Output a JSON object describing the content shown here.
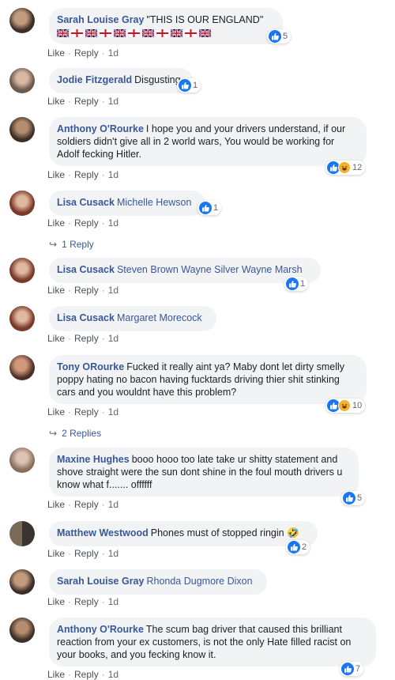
{
  "actions": {
    "like": "Like",
    "reply": "Reply",
    "sep": "·"
  },
  "colors": {
    "link": "#385898",
    "bubble": "#f2f3f5",
    "like_blue": "#1877f2",
    "haha_yellow": "#f7b125"
  },
  "flags_icons": [
    "uk-flag-icon",
    "england-flag-icon",
    "uk-flag-icon",
    "england-flag-icon",
    "uk-flag-icon",
    "england-flag-icon",
    "uk-flag-icon",
    "england-flag-icon",
    "uk-flag-icon",
    "england-flag-icon",
    "uk-flag-icon"
  ],
  "comments": [
    {
      "author": "Sarah Louise Gray",
      "text": "\"THIS IS OUR ENGLAND\"",
      "time": "1d",
      "reactions": "5",
      "reaction_icons": [
        "like-icon"
      ]
    },
    {
      "author": "Jodie Fitzgerald",
      "text": "Disgusting",
      "time": "1d",
      "reactions": "1",
      "reaction_icons": [
        "like-icon"
      ]
    },
    {
      "author": "Anthony O'Rourke",
      "text": "I hope you and your drivers understand, if our soldiers didn't give all in 2 world wars, You would be working for Adolf fecking Hitler.",
      "time": "1d",
      "reactions": "12",
      "reaction_icons": [
        "like-icon",
        "haha-icon"
      ]
    },
    {
      "author": "Lisa Cusack",
      "tagged": "Michelle Hewson",
      "time": "1d",
      "reactions": "1",
      "reaction_icons": [
        "like-icon"
      ],
      "replies": "1 Reply"
    },
    {
      "author": "Lisa Cusack",
      "tagged": "Steven Brown Wayne Silver Wayne Marsh",
      "time": "1d",
      "reactions": "1",
      "reaction_icons": [
        "like-icon"
      ]
    },
    {
      "author": "Lisa Cusack",
      "tagged": "Margaret Morecock",
      "time": "1d"
    },
    {
      "author": "Tony ORourke",
      "text": "Fucked it really aint ya? Maby dont let dirty smelly poppy hating no bacon having fucktards driving thier shit stinking cars and you wouldnt have this problem?",
      "time": "1d",
      "reactions": "10",
      "reaction_icons": [
        "like-icon",
        "haha-icon"
      ],
      "replies": "2 Replies"
    },
    {
      "author": "Maxine Hughes",
      "text": "booo hooo too late take ur shitty statement and shove straight were the sun dont shine in the foul mouth drivers u know what f....... offffff",
      "time": "1d",
      "reactions": "5",
      "reaction_icons": [
        "like-icon"
      ]
    },
    {
      "author": "Matthew Westwood",
      "text": "Phones must of stopped ringin",
      "emoji": "🤣",
      "time": "1d",
      "reactions": "2",
      "reaction_icons": [
        "like-icon"
      ]
    },
    {
      "author": "Sarah Louise Gray",
      "tagged": "Rhonda Dugmore Dixon",
      "time": "1d"
    },
    {
      "author": "Anthony O'Rourke",
      "text": "The scum bag driver that caused this brilliant reaction from your ex customers, is not the only Hate filled racist on your books, and you fecking know it.",
      "time": "1d",
      "reactions": "7",
      "reaction_icons": [
        "like-icon"
      ]
    }
  ]
}
